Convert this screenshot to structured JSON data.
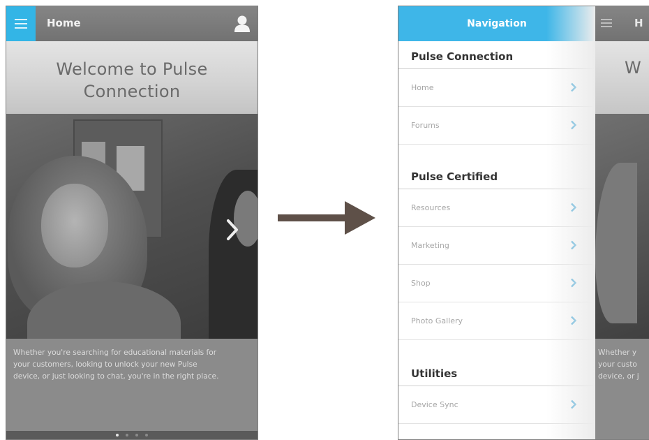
{
  "left_screen": {
    "header": {
      "title": "Home",
      "menu_icon": "hamburger-menu-icon",
      "user_icon": "user-icon"
    },
    "welcome": {
      "line1": "Welcome to Pulse",
      "line2": "Connection"
    },
    "hero": {
      "next_icon": "chevron-right-icon"
    },
    "caption": {
      "line1": "Whether you're searching for educational materials for",
      "line2": "your customers, looking to unlock your new Pulse",
      "line3": "device, or just looking to chat, you're in the right place."
    },
    "pager": {
      "count": 4,
      "active_index": 0
    }
  },
  "right_screen": {
    "drawer": {
      "title": "Navigation",
      "sections": [
        {
          "title": "Pulse Connection",
          "items": [
            {
              "label": "Home"
            },
            {
              "label": "Forums"
            }
          ]
        },
        {
          "title": "Pulse Certified",
          "items": [
            {
              "label": "Resources"
            },
            {
              "label": "Marketing"
            },
            {
              "label": "Shop"
            },
            {
              "label": "Photo Gallery"
            }
          ]
        },
        {
          "title": "Utilities",
          "items": [
            {
              "label": "Device Sync"
            }
          ]
        }
      ]
    },
    "behind": {
      "header_title": "H",
      "welcome_partial": "W",
      "caption_line1": "Whether y",
      "caption_line2": "your custo",
      "caption_line3": "device, or j"
    }
  },
  "colors": {
    "accent_blue": "#33b5e6",
    "drawer_header_blue": "#3eb6e8",
    "chevron_blue": "#2c9fd6",
    "arrow_brown": "#5e5048"
  }
}
